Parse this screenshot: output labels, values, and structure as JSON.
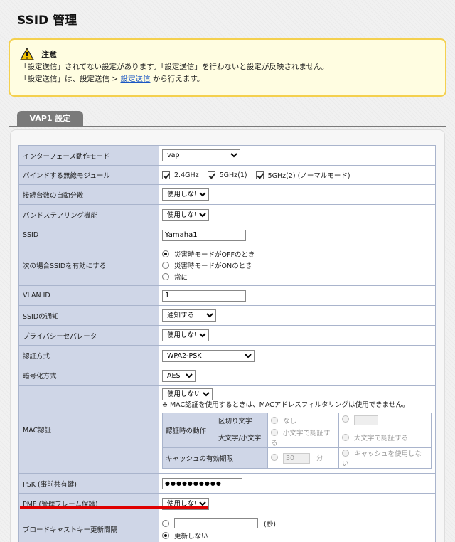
{
  "page": {
    "title": "SSID 管理"
  },
  "notice": {
    "title": "注意",
    "line1": "「設定送信」されてない設定があります。「設定送信」を行わないと設定が反映されません。",
    "line2_pre": "「設定送信」は、設定送信 > ",
    "line2_link": "設定送信",
    "line2_post": " から行えます。"
  },
  "tab": {
    "label": "VAP1 設定"
  },
  "rows": {
    "interface_mode": {
      "label": "インターフェース動作モード",
      "value": "vap"
    },
    "bind_module": {
      "label": "バインドする無線モジュール",
      "opt1": "2.4GHz",
      "opt2": "5GHz(1)",
      "opt3": "5GHz(2) (ノーマルモード)"
    },
    "auto_distribution": {
      "label": "接続台数の自動分散",
      "value": "使用しない"
    },
    "band_steering": {
      "label": "バンドステアリング機能",
      "value": "使用しない"
    },
    "ssid": {
      "label": "SSID",
      "value": "Yamaha1"
    },
    "ssid_enable": {
      "label": "次の場合SSIDを有効にする",
      "opt1": "災害時モードがOFFのとき",
      "opt2": "災害時モードがONのとき",
      "opt3": "常に"
    },
    "vlan_id": {
      "label": "VLAN ID",
      "value": "1"
    },
    "ssid_notify": {
      "label": "SSIDの通知",
      "value": "通知する"
    },
    "privacy_separator": {
      "label": "プライバシーセパレータ",
      "value": "使用しない"
    },
    "auth_method": {
      "label": "認証方式",
      "value": "WPA2-PSK"
    },
    "encryption": {
      "label": "暗号化方式",
      "value": "AES"
    },
    "mac_auth": {
      "label": "MAC認証",
      "value": "使用しない",
      "note": "※ MAC認証を使用するときは、MACアドレスフィルタリングは使用できません。",
      "op_label": "認証時の動作",
      "delimiter_label": "区切り文字",
      "delimiter_none": "なし",
      "case_label": "大文字/小文字",
      "lowercase": "小文字で認証する",
      "uppercase": "大文字で認証する",
      "cache_label": "キャッシュの有効期限",
      "cache_value": "30",
      "cache_unit": "分",
      "cache_off": "キャッシュを使用しない"
    },
    "psk": {
      "label": "PSK (事前共有鍵)",
      "value": "●●●●●●●●●●"
    },
    "pmf": {
      "label": "PMF (管理フレーム保護)",
      "value": "使用しない"
    },
    "broadcast_key": {
      "label": "ブロードキャストキー更新間隔",
      "unit": "(秒)",
      "opt2": "更新しない"
    }
  },
  "colors": {
    "highlight": "#e00000",
    "label_bg": "#cfd6e7",
    "notice_border": "#f4d04e"
  }
}
